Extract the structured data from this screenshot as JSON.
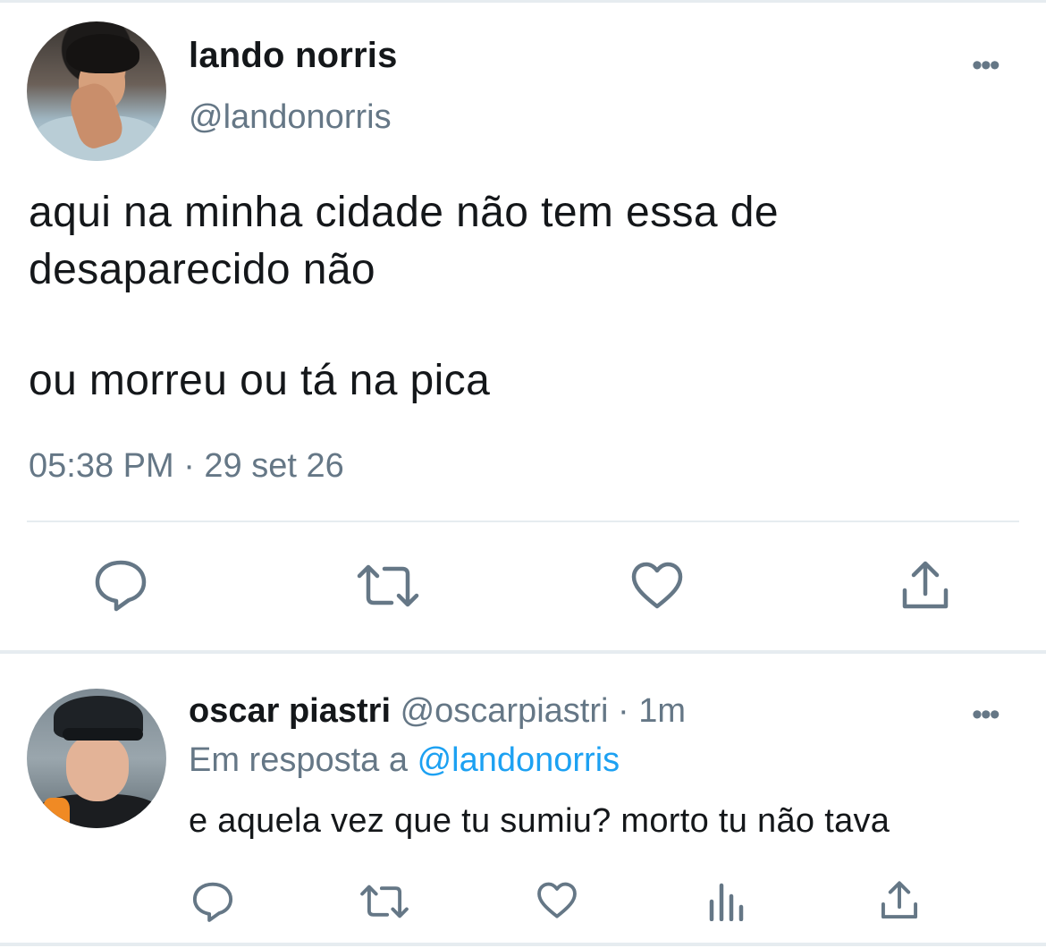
{
  "main_tweet": {
    "author_name": "lando norris",
    "author_handle": "@landonorris",
    "text_line1": "aqui na minha cidade não tem essa de",
    "text_line2": "desaparecido não",
    "text_line3": "ou morreu ou tá na pica",
    "timestamp": "05:38 PM · 29 set 26",
    "more_label": "•••"
  },
  "reply": {
    "author_name": "oscar piastri",
    "meta": "@oscarpiastri · 1m",
    "replying_prefix": "Em resposta a",
    "replying_mention": "@landonorris",
    "text": "e aquela vez que tu sumiu? morto tu não tava",
    "more_label": "•••"
  },
  "icons": {
    "reply": "reply-icon",
    "retweet": "retweet-icon",
    "like": "heart-icon",
    "share": "share-icon",
    "analytics": "analytics-icon",
    "more": "more-icon"
  },
  "colors": {
    "text": "#14171a",
    "secondary": "#657786",
    "link": "#1da1f2",
    "divider": "#e6ecf0"
  }
}
